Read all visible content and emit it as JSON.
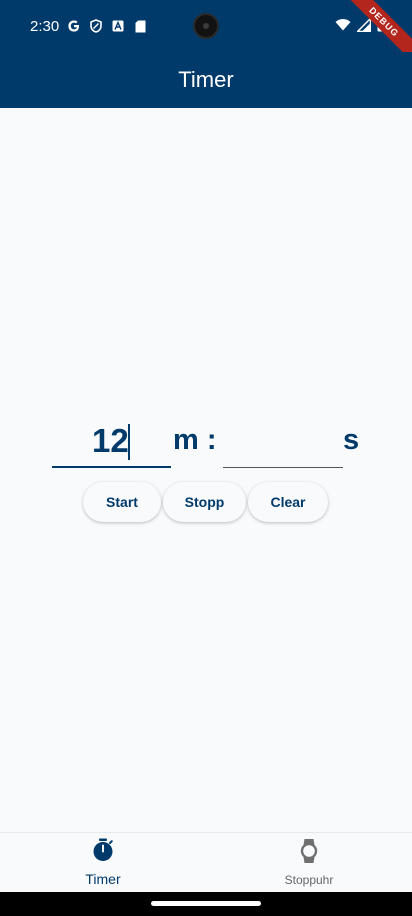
{
  "status": {
    "time": "2:30",
    "icons": [
      "google-icon",
      "shield-icon",
      "a-box-icon",
      "sd-card-icon",
      "wifi-icon",
      "signal-icon",
      "battery-icon"
    ]
  },
  "debug_banner": "DEBUG",
  "appbar": {
    "title": "Timer"
  },
  "timer": {
    "minutes_value": "12",
    "minutes_unit": "m :",
    "seconds_value": "",
    "seconds_unit": "s"
  },
  "buttons": {
    "start": "Start",
    "stop": "Stopp",
    "clear": "Clear"
  },
  "nav": {
    "timer_label": "Timer",
    "stopwatch_label": "Stoppuhr"
  },
  "colors": {
    "primary": "#003a6a",
    "background": "#f8fafb"
  }
}
